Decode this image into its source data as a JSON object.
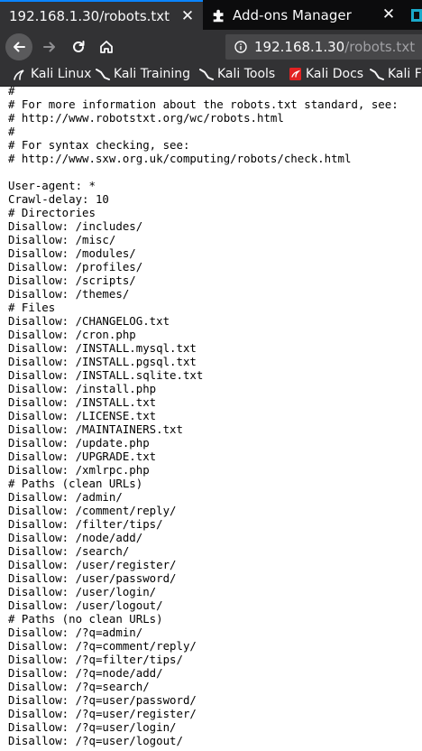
{
  "tabs": {
    "active": {
      "title": "192.168.1.30/robots.txt",
      "close": "✕"
    },
    "inactive": {
      "title": "Add-ons Manager",
      "close": "✕"
    }
  },
  "navigation": {
    "url_host": "192.168.1.30",
    "url_path": "/robots.txt"
  },
  "bookmarks": [
    {
      "label": "Kali Linux",
      "icon": "kali-dragon-icon"
    },
    {
      "label": "Kali Training",
      "icon": "kali-dragon-icon"
    },
    {
      "label": "Kali Tools",
      "icon": "kali-dragon-icon"
    },
    {
      "label": "Kali Docs",
      "icon": "kali-docs-icon"
    },
    {
      "label": "Kali F",
      "icon": "kali-dragon-icon"
    }
  ],
  "colors": {
    "tab_accent": "#0a84ff",
    "toolbar": "#323234",
    "titlebar": "#0c0c0d",
    "docs_icon": "#e22222"
  },
  "document": {
    "text": "#\n# For more information about the robots.txt standard, see:\n# http://www.robotstxt.org/wc/robots.html\n#\n# For syntax checking, see:\n# http://www.sxw.org.uk/computing/robots/check.html\n\nUser-agent: *\nCrawl-delay: 10\n# Directories\nDisallow: /includes/\nDisallow: /misc/\nDisallow: /modules/\nDisallow: /profiles/\nDisallow: /scripts/\nDisallow: /themes/\n# Files\nDisallow: /CHANGELOG.txt\nDisallow: /cron.php\nDisallow: /INSTALL.mysql.txt\nDisallow: /INSTALL.pgsql.txt\nDisallow: /INSTALL.sqlite.txt\nDisallow: /install.php\nDisallow: /INSTALL.txt\nDisallow: /LICENSE.txt\nDisallow: /MAINTAINERS.txt\nDisallow: /update.php\nDisallow: /UPGRADE.txt\nDisallow: /xmlrpc.php\n# Paths (clean URLs)\nDisallow: /admin/\nDisallow: /comment/reply/\nDisallow: /filter/tips/\nDisallow: /node/add/\nDisallow: /search/\nDisallow: /user/register/\nDisallow: /user/password/\nDisallow: /user/login/\nDisallow: /user/logout/\n# Paths (no clean URLs)\nDisallow: /?q=admin/\nDisallow: /?q=comment/reply/\nDisallow: /?q=filter/tips/\nDisallow: /?q=node/add/\nDisallow: /?q=search/\nDisallow: /?q=user/password/\nDisallow: /?q=user/register/\nDisallow: /?q=user/login/\nDisallow: /?q=user/logout/"
  }
}
